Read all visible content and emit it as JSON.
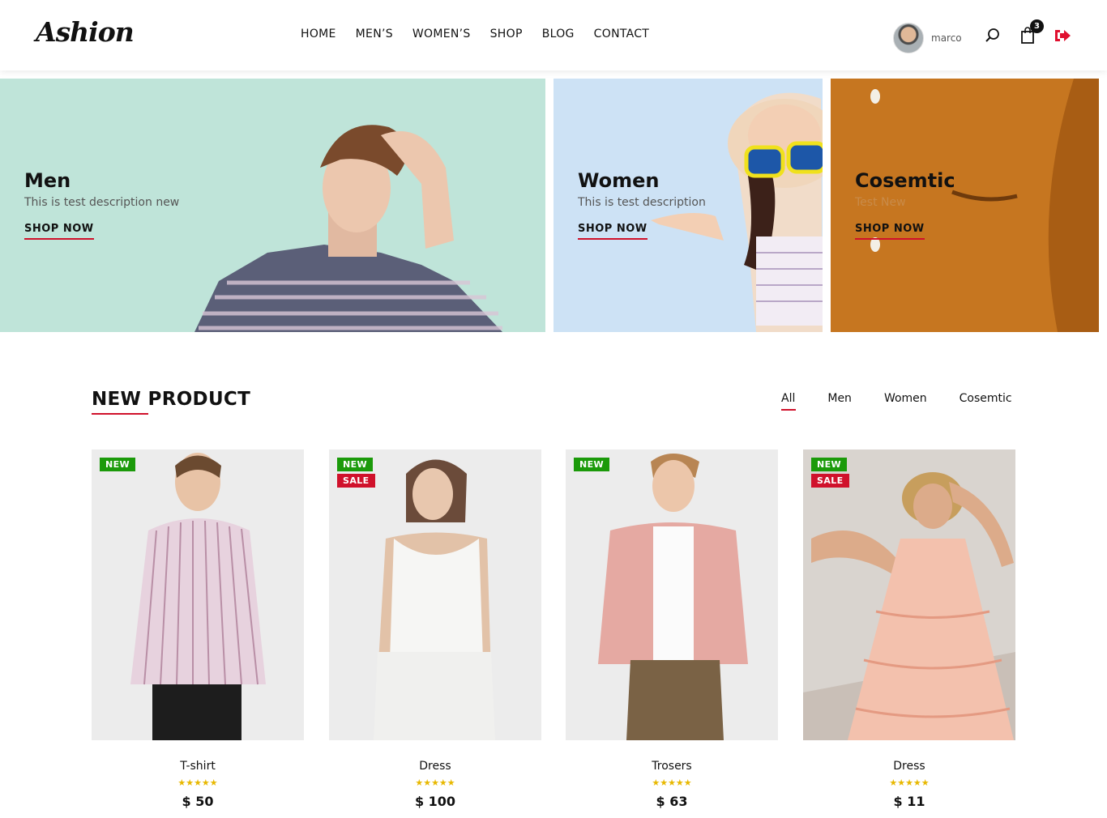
{
  "header": {
    "logo": "Ashion",
    "nav": [
      "HOME",
      "MEN’S",
      "WOMEN’S",
      "SHOP",
      "BLOG",
      "CONTACT"
    ],
    "username": "marco",
    "cart_count": "3"
  },
  "banners": [
    {
      "title": "Men",
      "description": "This is test description new",
      "link": "SHOP NOW"
    },
    {
      "title": "Women",
      "description": "This is test description",
      "link": "SHOP NOW"
    },
    {
      "title": "Cosemtic",
      "description": "Test New",
      "link": "SHOP NOW"
    }
  ],
  "section": {
    "title": "NEW PRODUCT",
    "filters": [
      "All",
      "Men",
      "Women",
      "Cosemtic"
    ],
    "active_filter": "All"
  },
  "products": [
    {
      "name": "T-shirt",
      "price": "$ 50",
      "tags": [
        "NEW"
      ],
      "rating": "★★★★★"
    },
    {
      "name": "Dress",
      "price": "$ 100",
      "tags": [
        "NEW",
        "SALE"
      ],
      "rating": "★★★★★"
    },
    {
      "name": "Trosers",
      "price": "$ 63",
      "tags": [
        "NEW"
      ],
      "rating": "★★★★★"
    },
    {
      "name": "Dress",
      "price": "$ 11",
      "tags": [
        "NEW",
        "SALE"
      ],
      "rating": "★★★★★"
    }
  ],
  "colors": {
    "accent": "#d0112b",
    "new_tag": "#1b9a0a",
    "star": "#e8b800"
  }
}
